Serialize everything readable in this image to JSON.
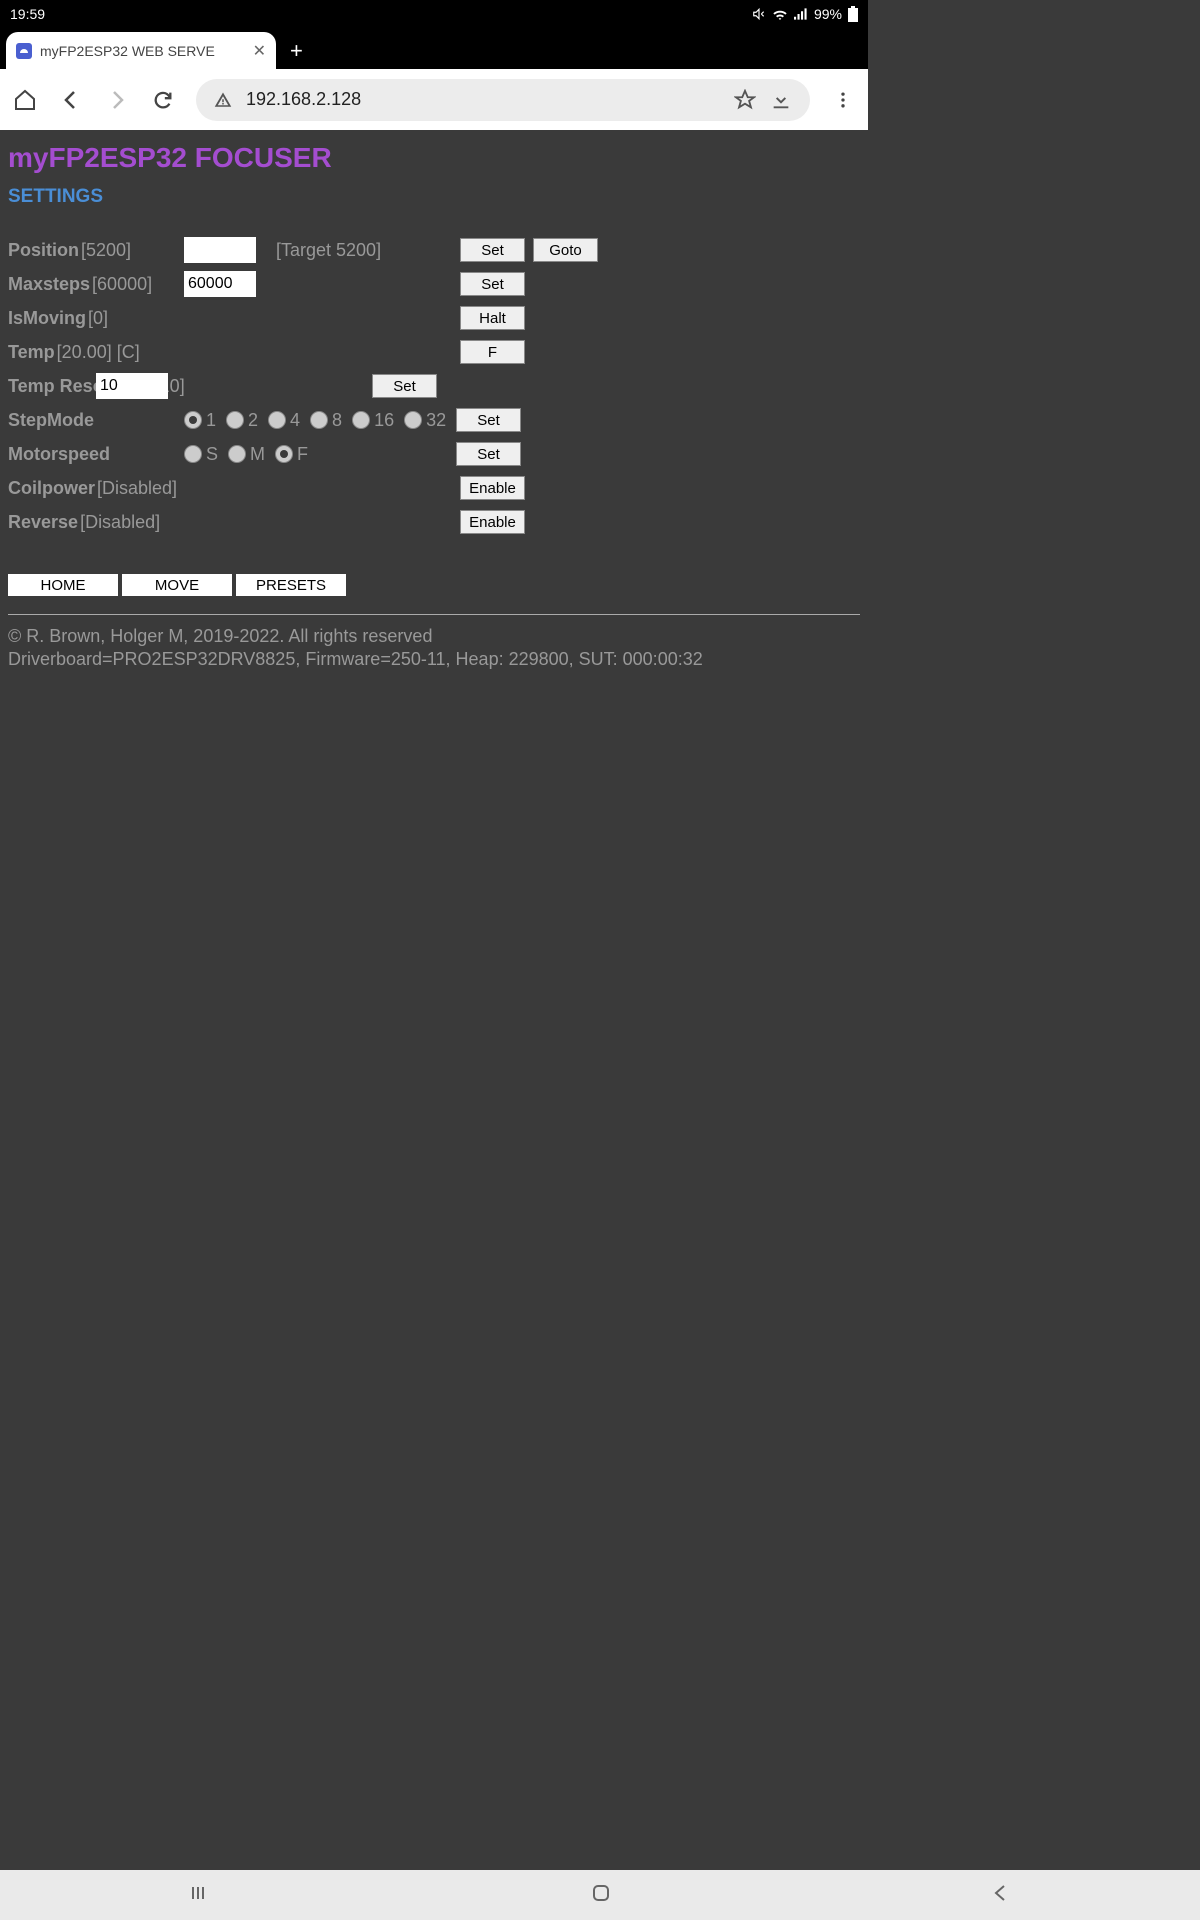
{
  "status": {
    "time": "19:59",
    "battery": "99%"
  },
  "tab": {
    "title": "myFP2ESP32 WEB SERVE"
  },
  "url": "192.168.2.128",
  "page": {
    "title": "myFP2ESP32 FOCUSER",
    "subtitle": "SETTINGS"
  },
  "fields": {
    "position": {
      "label": "Position",
      "value": "[5200]",
      "input": "",
      "target": "[Target 5200]",
      "set": "Set",
      "goto": "Goto"
    },
    "maxsteps": {
      "label": "Maxsteps",
      "value": "[60000]",
      "input": "60000",
      "set": "Set"
    },
    "ismoving": {
      "label": "IsMoving",
      "value": "[0]",
      "halt": "Halt"
    },
    "temp": {
      "label": "Temp",
      "value": "[20.00] [C]",
      "btn": "F"
    },
    "tempres": {
      "label": "Temp Resolution",
      "value": "[10]",
      "input": "10",
      "set": "Set"
    },
    "stepmode": {
      "label": "StepMode",
      "options": [
        "1",
        "2",
        "4",
        "8",
        "16",
        "32"
      ],
      "selected": "1",
      "set": "Set"
    },
    "motorspeed": {
      "label": "Motorspeed",
      "options": [
        "S",
        "M",
        "F"
      ],
      "selected": "F",
      "set": "Set"
    },
    "coilpower": {
      "label": "Coilpower",
      "value": "[Disabled]",
      "btn": "Enable"
    },
    "reverse": {
      "label": "Reverse",
      "value": "[Disabled]",
      "btn": "Enable"
    }
  },
  "nav_btns": {
    "home": "HOME",
    "move": "MOVE",
    "presets": "PRESETS"
  },
  "footer": {
    "line1": "© R. Brown, Holger M, 2019-2022. All rights reserved",
    "line2": "Driverboard=PRO2ESP32DRV8825, Firmware=250-11, Heap: 229800, SUT: 000:00:32"
  }
}
